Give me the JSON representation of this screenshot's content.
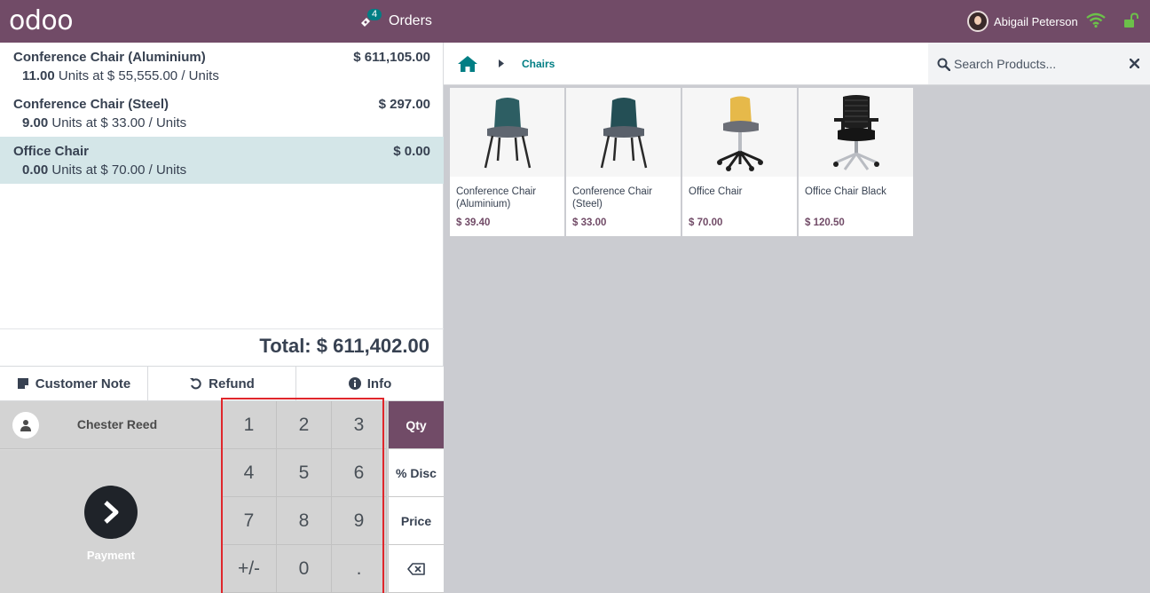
{
  "app": {
    "logo": "odoo",
    "orders_label": "Orders",
    "orders_badge": "4",
    "user_name": "Abigail Peterson",
    "brand_color": "#714B67",
    "accent_color": "#017E84"
  },
  "order": {
    "lines": [
      {
        "name": "Conference Chair (Aluminium)",
        "price": "$ 611,105.00",
        "qty": "11.00",
        "unit_info": "Units at $ 55,555.00 / Units",
        "selected": false
      },
      {
        "name": "Conference Chair (Steel)",
        "price": "$ 297.00",
        "qty": "9.00",
        "unit_info": "Units at $ 33.00 / Units",
        "selected": false
      },
      {
        "name": "Office Chair",
        "price": "$ 0.00",
        "qty": "0.00",
        "unit_info": "Units at $ 70.00 / Units",
        "selected": true
      }
    ],
    "total": "Total: $ 611,402.00"
  },
  "controls": {
    "customer_note": "Customer Note",
    "refund": "Refund",
    "info": "Info"
  },
  "customer": {
    "name": "Chester Reed"
  },
  "payment": {
    "label": "Payment"
  },
  "numpad": {
    "keys": [
      "1",
      "2",
      "3",
      "4",
      "5",
      "6",
      "7",
      "8",
      "9",
      "+/-",
      "0",
      "."
    ],
    "modes": [
      "Qty",
      "% Disc",
      "Price"
    ],
    "active_mode": "Qty",
    "backspace_icon": "backspace-icon"
  },
  "catalog": {
    "breadcrumb": "Chairs",
    "search_placeholder": "Search Products...",
    "products": [
      {
        "name": "Conference Chair (Aluminium)",
        "price": "$ 39.40",
        "image": "teal-chair"
      },
      {
        "name": "Conference Chair (Steel)",
        "price": "$ 33.00",
        "image": "teal-chair"
      },
      {
        "name": "Office Chair",
        "price": "$ 70.00",
        "image": "yellow-swivel-chair"
      },
      {
        "name": "Office Chair Black",
        "price": "$ 120.50",
        "image": "black-mesh-chair"
      }
    ]
  }
}
